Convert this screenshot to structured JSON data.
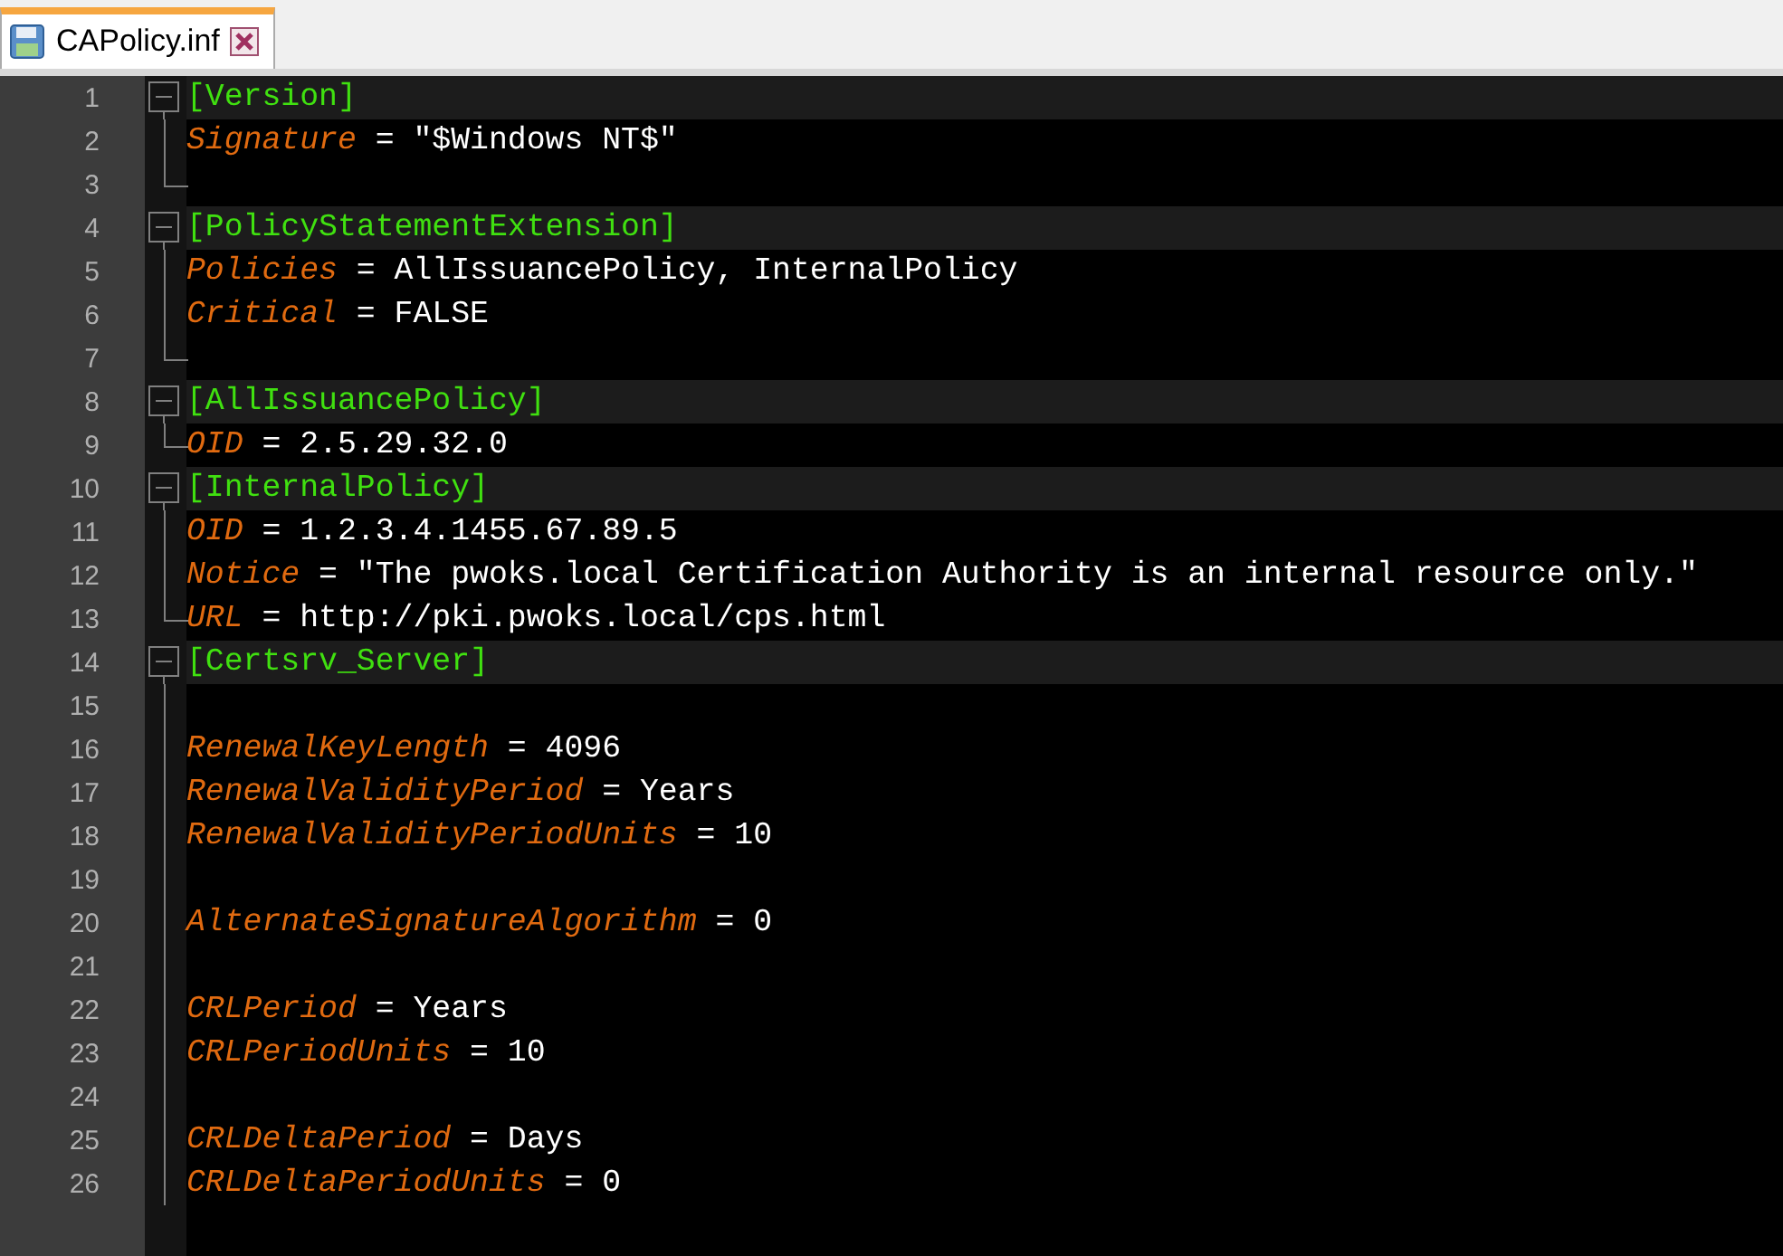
{
  "tabs": [
    {
      "label": "CAPolicy.inf",
      "selected": true
    }
  ],
  "lines": [
    {
      "number": "1",
      "kind": "section",
      "text": "[Version]"
    },
    {
      "number": "2",
      "kind": "pair",
      "block_end": false,
      "key": "Signature",
      "value": "= \"$Windows NT$\""
    },
    {
      "number": "3",
      "kind": "blank",
      "block_end": true
    },
    {
      "number": "4",
      "kind": "section",
      "text": "[PolicyStatementExtension]"
    },
    {
      "number": "5",
      "kind": "pair",
      "block_end": false,
      "key": "Policies",
      "value": "= AllIssuancePolicy, InternalPolicy"
    },
    {
      "number": "6",
      "kind": "pair",
      "block_end": false,
      "key": "Critical",
      "value": "= FALSE"
    },
    {
      "number": "7",
      "kind": "blank",
      "block_end": true
    },
    {
      "number": "8",
      "kind": "section",
      "text": "[AllIssuancePolicy]"
    },
    {
      "number": "9",
      "kind": "pair",
      "block_end": true,
      "key": "OID",
      "value": "= 2.5.29.32.0"
    },
    {
      "number": "10",
      "kind": "section",
      "text": "[InternalPolicy]"
    },
    {
      "number": "11",
      "kind": "pair",
      "block_end": false,
      "key": "OID",
      "value": "= 1.2.3.4.1455.67.89.5"
    },
    {
      "number": "12",
      "kind": "pair",
      "block_end": false,
      "key": "Notice",
      "value": "= \"The pwoks.local Certification Authority is an internal resource only.\""
    },
    {
      "number": "13",
      "kind": "pair",
      "block_end": true,
      "key": "URL",
      "value": "= http://pki.pwoks.local/cps.html"
    },
    {
      "number": "14",
      "kind": "section",
      "text": "[Certsrv_Server]"
    },
    {
      "number": "15",
      "kind": "blank",
      "block_end": false
    },
    {
      "number": "16",
      "kind": "pair",
      "block_end": false,
      "key": "RenewalKeyLength",
      "value": "= 4096"
    },
    {
      "number": "17",
      "kind": "pair",
      "block_end": false,
      "key": "RenewalValidityPeriod",
      "value": "= Years"
    },
    {
      "number": "18",
      "kind": "pair",
      "block_end": false,
      "key": "RenewalValidityPeriodUnits",
      "value": "= 10"
    },
    {
      "number": "19",
      "kind": "blank",
      "block_end": false
    },
    {
      "number": "20",
      "kind": "pair",
      "block_end": false,
      "key": "AlternateSignatureAlgorithm",
      "value": "= 0"
    },
    {
      "number": "21",
      "kind": "blank",
      "block_end": false
    },
    {
      "number": "22",
      "kind": "pair",
      "block_end": false,
      "key": "CRLPeriod",
      "value": "= Years"
    },
    {
      "number": "23",
      "kind": "pair",
      "block_end": false,
      "key": "CRLPeriodUnits",
      "value": "= 10"
    },
    {
      "number": "24",
      "kind": "blank",
      "block_end": false
    },
    {
      "number": "25",
      "kind": "pair",
      "block_end": false,
      "key": "CRLDeltaPeriod",
      "value": "= Days"
    },
    {
      "number": "26",
      "kind": "pair",
      "block_end": false,
      "key": "CRLDeltaPeriodUnits",
      "value": "= 0"
    }
  ]
}
